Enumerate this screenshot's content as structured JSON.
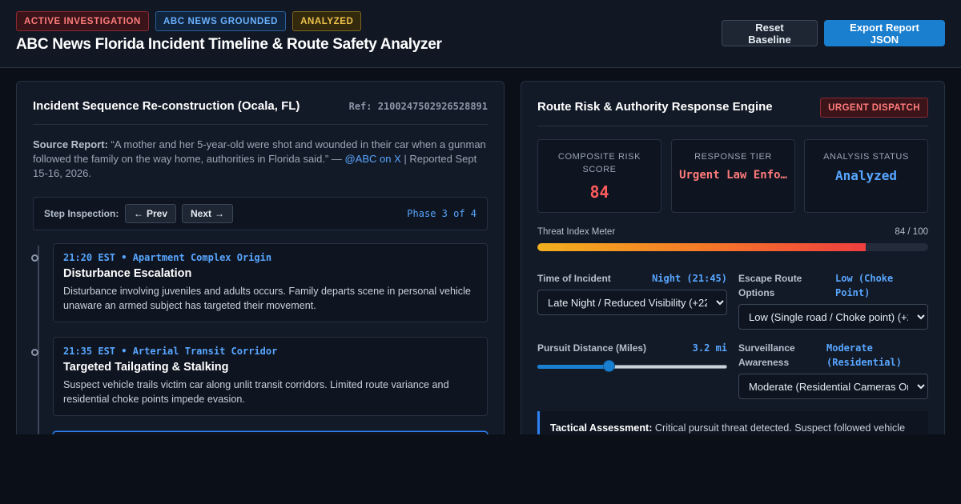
{
  "header": {
    "badges": [
      "ACTIVE INVESTIGATION",
      "ABC NEWS GROUNDED",
      "ANALYZED"
    ],
    "title": "ABC News Florida Incident Timeline & Route Safety Analyzer",
    "reset_label": "Reset Baseline",
    "export_label": "Export Report JSON"
  },
  "timeline_panel": {
    "title": "Incident Sequence Re-construction (Ocala, FL)",
    "ref": "Ref: 2100247502926528891",
    "source_label": "Source Report:",
    "source_quote": " “A mother and her 5-year-old were shot and wounded in their car when a gunman followed the family on the way home, authorities in Florida said.” — ",
    "source_link": "@ABC on X",
    "source_date": " | Reported Sept 15-16, 2026.",
    "step_label": "Step Inspection:",
    "prev_label": "Prev",
    "next_label": "Next",
    "phase": "Phase 3 of 4",
    "events": [
      {
        "time": "21:20 EST • Apartment Complex Origin",
        "title": "Disturbance Escalation",
        "desc": "Disturbance involving juveniles and adults occurs. Family departs scene in personal vehicle unaware an armed subject has targeted their movement."
      },
      {
        "time": "21:35 EST • Arterial Transit Corridor",
        "title": "Targeted Tailgating & Stalking",
        "desc": "Suspect vehicle trails victim car along unlit transit corridors. Limited route variance and residential choke points impede evasion."
      }
    ]
  },
  "risk_panel": {
    "title": "Route Risk & Authority Response Engine",
    "badge": "URGENT DISPATCH",
    "stats": [
      {
        "label": "COMPOSITE RISK SCORE",
        "value": "84"
      },
      {
        "label": "RESPONSE TIER",
        "value": "Urgent Law Enfo…"
      },
      {
        "label": "ANALYSIS STATUS",
        "value": "Analyzed"
      }
    ],
    "meter_label": "Threat Index Meter",
    "meter_value_text": "84 / 100",
    "meter_fraction": 0.84,
    "controls": {
      "time_label": "Time of Incident",
      "time_value": "Night (21:45)",
      "time_selected": "Late Night / Reduced Visibility (+22)",
      "escape_label": "Escape Route Options",
      "escape_value": "Low (Choke Point)",
      "escape_selected": "Low (Single road / Choke point) (+2",
      "distance_label": "Pursuit Distance (Miles)",
      "distance_value": "3.2 mi",
      "distance_fraction": 0.37,
      "surveillance_label": "Surveillance Awareness",
      "surveillance_value": "Moderate (Residential)",
      "surveillance_selected": "Moderate (Residential Cameras Or"
    },
    "assessment_label": "Tactical Assessment:",
    "assessment_text": " Critical pursuit threat detected. Suspect followed vehicle"
  },
  "colors": {
    "accent": "#1a7fcf",
    "danger": "#ff5c5c",
    "info": "#58a6ff"
  }
}
